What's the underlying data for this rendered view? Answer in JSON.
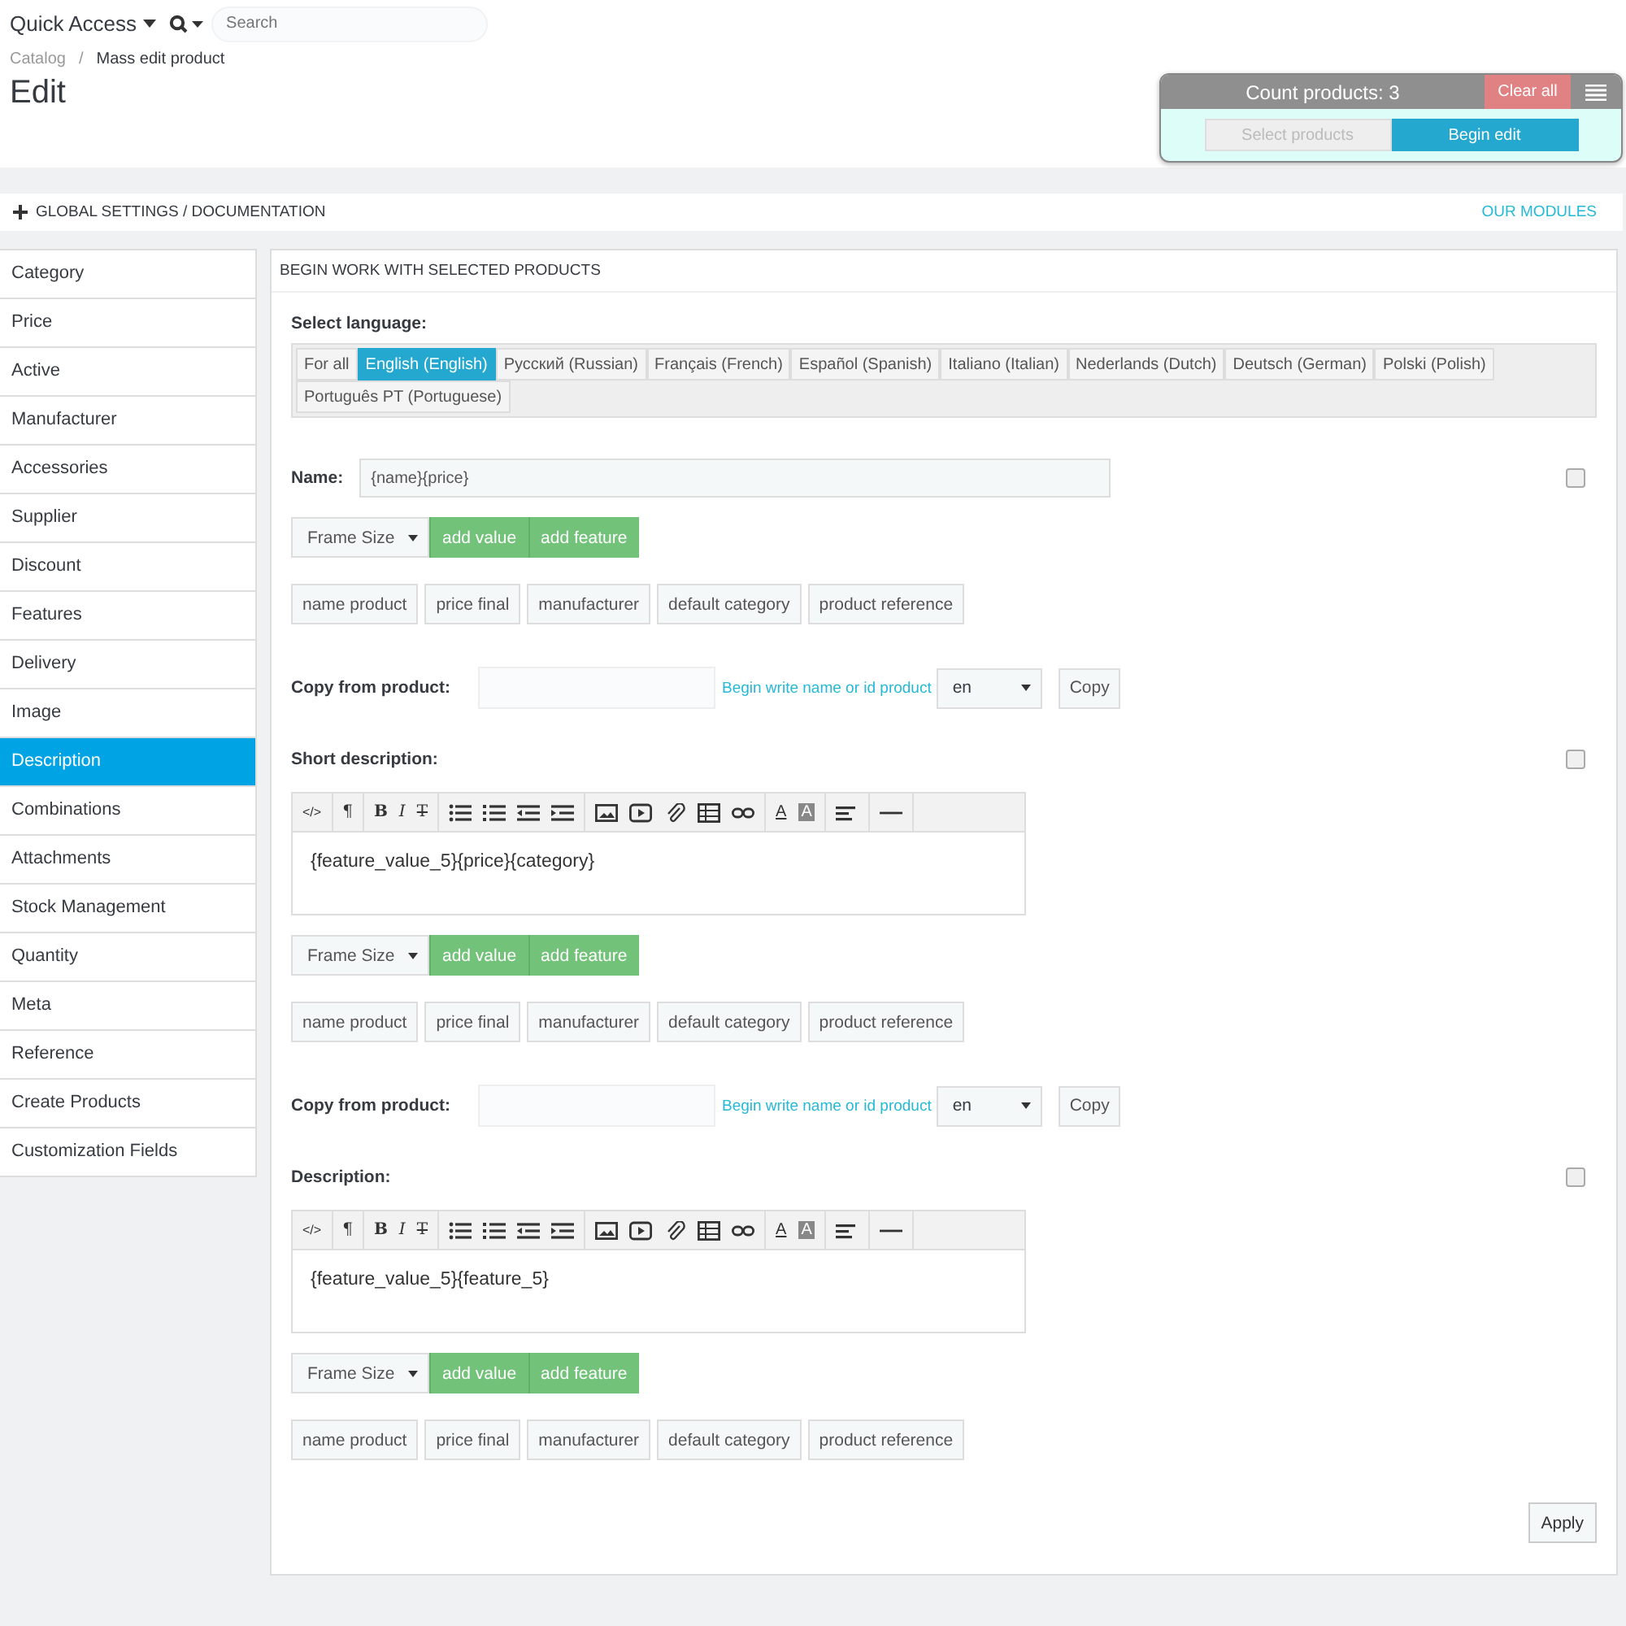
{
  "header": {
    "quick_access": "Quick Access",
    "search_placeholder": "Search"
  },
  "breadcrumb": [
    "Catalog",
    "Mass edit product"
  ],
  "breadcrumb_separator": "/",
  "page_title": "Edit",
  "count_panel": {
    "count": "Count products: 3",
    "clear": "Clear all",
    "tabs": [
      {
        "label": "Select products",
        "selected": false
      },
      {
        "label": "Begin edit",
        "selected": true
      }
    ]
  },
  "settings_bar": {
    "title": "GLOBAL SETTINGS / DOCUMENTATION",
    "link": "OUR MODULES"
  },
  "sidebar": {
    "items": [
      {
        "label": "Category",
        "selected": false
      },
      {
        "label": "Price",
        "selected": false
      },
      {
        "label": "Active",
        "selected": false
      },
      {
        "label": "Manufacturer",
        "selected": false
      },
      {
        "label": "Accessories",
        "selected": false
      },
      {
        "label": "Supplier",
        "selected": false
      },
      {
        "label": "Discount",
        "selected": false
      },
      {
        "label": "Features",
        "selected": false
      },
      {
        "label": "Delivery",
        "selected": false
      },
      {
        "label": "Image",
        "selected": false
      },
      {
        "label": "Description",
        "selected": true
      },
      {
        "label": "Combinations",
        "selected": false
      },
      {
        "label": "Attachments",
        "selected": false
      },
      {
        "label": "Stock Management",
        "selected": false
      },
      {
        "label": "Quantity",
        "selected": false
      },
      {
        "label": "Meta",
        "selected": false
      },
      {
        "label": "Reference",
        "selected": false
      },
      {
        "label": "Create Products",
        "selected": false
      },
      {
        "label": "Customization Fields",
        "selected": false
      }
    ]
  },
  "panel": {
    "title": "BEGIN WORK WITH SELECTED PRODUCTS",
    "language_label": "Select language:",
    "languages": [
      {
        "label": "For all",
        "selected": false
      },
      {
        "label": "English (English)",
        "selected": true
      },
      {
        "label": "Русский (Russian)",
        "selected": false
      },
      {
        "label": "Français (French)",
        "selected": false
      },
      {
        "label": "Español (Spanish)",
        "selected": false
      },
      {
        "label": "Italiano (Italian)",
        "selected": false
      },
      {
        "label": "Nederlands (Dutch)",
        "selected": false
      },
      {
        "label": "Deutsch (German)",
        "selected": false
      },
      {
        "label": "Polski (Polish)",
        "selected": false
      },
      {
        "label": "Português PT (Portuguese)",
        "selected": false
      }
    ],
    "sections": [
      {
        "kind": "input",
        "label": "Name:",
        "value": "{name}{price}",
        "checked": false,
        "feature_select": "Frame Size",
        "feature_buttons": [
          "add value",
          "add feature"
        ],
        "tags": [
          "name product",
          "price final",
          "manufacturer",
          "default category",
          "product reference"
        ],
        "copy": {
          "label": "Copy from product:",
          "hint": "Begin write name or id product",
          "lang": "en",
          "button": "Copy"
        }
      },
      {
        "kind": "editor",
        "label": "Short description:",
        "value": "{feature_value_5}{price}{category}",
        "checked": false,
        "toolbar": [
          [
            {
              "kind": "code",
              "glyph": "</>"
            }
          ],
          [
            {
              "kind": "paragraph",
              "glyph": "¶"
            }
          ],
          [
            {
              "kind": "bold",
              "glyph": "B"
            },
            {
              "kind": "italic",
              "glyph": "I"
            },
            {
              "kind": "strike",
              "glyph": "T"
            }
          ],
          [
            {
              "kind": "ul"
            },
            {
              "kind": "ol"
            },
            {
              "kind": "outdent"
            },
            {
              "kind": "indent"
            }
          ],
          [
            {
              "kind": "image"
            },
            {
              "kind": "video"
            },
            {
              "kind": "attach"
            },
            {
              "kind": "table"
            },
            {
              "kind": "link"
            }
          ],
          [
            {
              "kind": "color",
              "glyph": "A"
            },
            {
              "kind": "bgcolor",
              "glyph": "A"
            }
          ],
          [
            {
              "kind": "align"
            }
          ],
          [
            {
              "kind": "hr"
            }
          ]
        ],
        "feature_select": "Frame Size",
        "feature_buttons": [
          "add value",
          "add feature"
        ],
        "tags": [
          "name product",
          "price final",
          "manufacturer",
          "default category",
          "product reference"
        ],
        "copy": {
          "label": "Copy from product:",
          "hint": "Begin write name or id product",
          "lang": "en",
          "button": "Copy"
        }
      },
      {
        "kind": "editor",
        "label": "Description:",
        "value": "{feature_value_5}{feature_5}",
        "checked": false,
        "toolbar": [
          [
            {
              "kind": "code",
              "glyph": "</>"
            }
          ],
          [
            {
              "kind": "paragraph",
              "glyph": "¶"
            }
          ],
          [
            {
              "kind": "bold",
              "glyph": "B"
            },
            {
              "kind": "italic",
              "glyph": "I"
            },
            {
              "kind": "strike",
              "glyph": "T"
            }
          ],
          [
            {
              "kind": "ul"
            },
            {
              "kind": "ol"
            },
            {
              "kind": "outdent"
            },
            {
              "kind": "indent"
            }
          ],
          [
            {
              "kind": "image"
            },
            {
              "kind": "video"
            },
            {
              "kind": "attach"
            },
            {
              "kind": "table"
            },
            {
              "kind": "link"
            }
          ],
          [
            {
              "kind": "color",
              "glyph": "A"
            },
            {
              "kind": "bgcolor",
              "glyph": "A"
            }
          ],
          [
            {
              "kind": "align"
            }
          ],
          [
            {
              "kind": "hr"
            }
          ]
        ],
        "feature_select": "Frame Size",
        "feature_buttons": [
          "add value",
          "add feature"
        ],
        "tags": [
          "name product",
          "price final",
          "manufacturer",
          "default category",
          "product reference"
        ]
      }
    ],
    "apply": "Apply"
  }
}
